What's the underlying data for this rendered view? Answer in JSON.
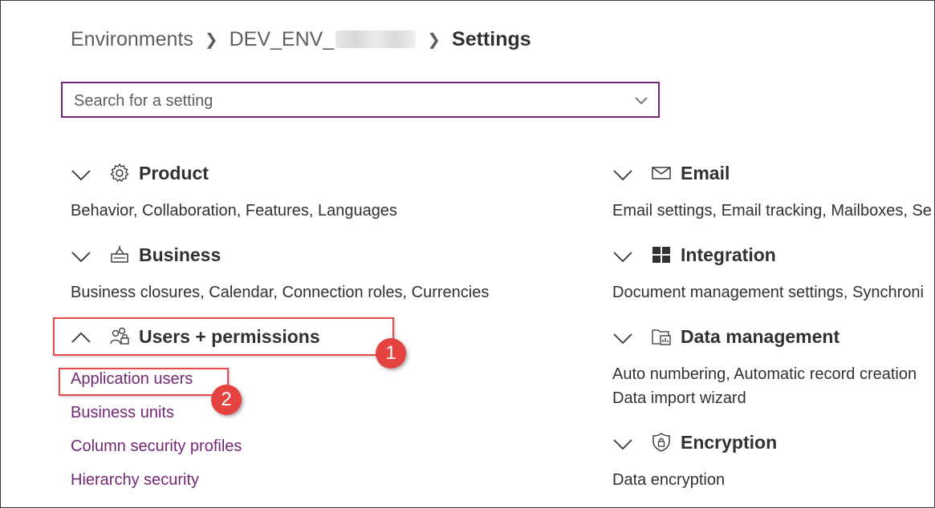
{
  "breadcrumb": {
    "items": [
      "Environments",
      "DEV_ENV_",
      "Settings"
    ],
    "separator": ">"
  },
  "search": {
    "placeholder": "Search for a setting",
    "value": ""
  },
  "left_sections": [
    {
      "title": "Product",
      "icon": "gear-icon",
      "expanded": false,
      "description": "Behavior, Collaboration, Features, Languages"
    },
    {
      "title": "Business",
      "icon": "business-icon",
      "expanded": false,
      "description": "Business closures, Calendar, Connection roles, Currencies"
    },
    {
      "title": "Users + permissions",
      "icon": "users-permissions-icon",
      "expanded": true,
      "links": [
        "Application users",
        "Business units",
        "Column security profiles",
        "Hierarchy security"
      ]
    }
  ],
  "right_sections": [
    {
      "title": "Email",
      "icon": "mail-icon",
      "expanded": false,
      "description": "Email settings, Email tracking, Mailboxes, Se"
    },
    {
      "title": "Integration",
      "icon": "windows-icon",
      "expanded": false,
      "description": "Document management settings, Synchroni"
    },
    {
      "title": "Data management",
      "icon": "data-management-icon",
      "expanded": false,
      "description": "Auto numbering, Automatic record creation",
      "description2": "Data import wizard"
    },
    {
      "title": "Encryption",
      "icon": "shield-icon",
      "expanded": false,
      "description": "Data encryption"
    }
  ],
  "callouts": [
    "1",
    "2"
  ],
  "colors": {
    "accent": "#742774",
    "callout": "#e5433f",
    "text": "#323130"
  }
}
